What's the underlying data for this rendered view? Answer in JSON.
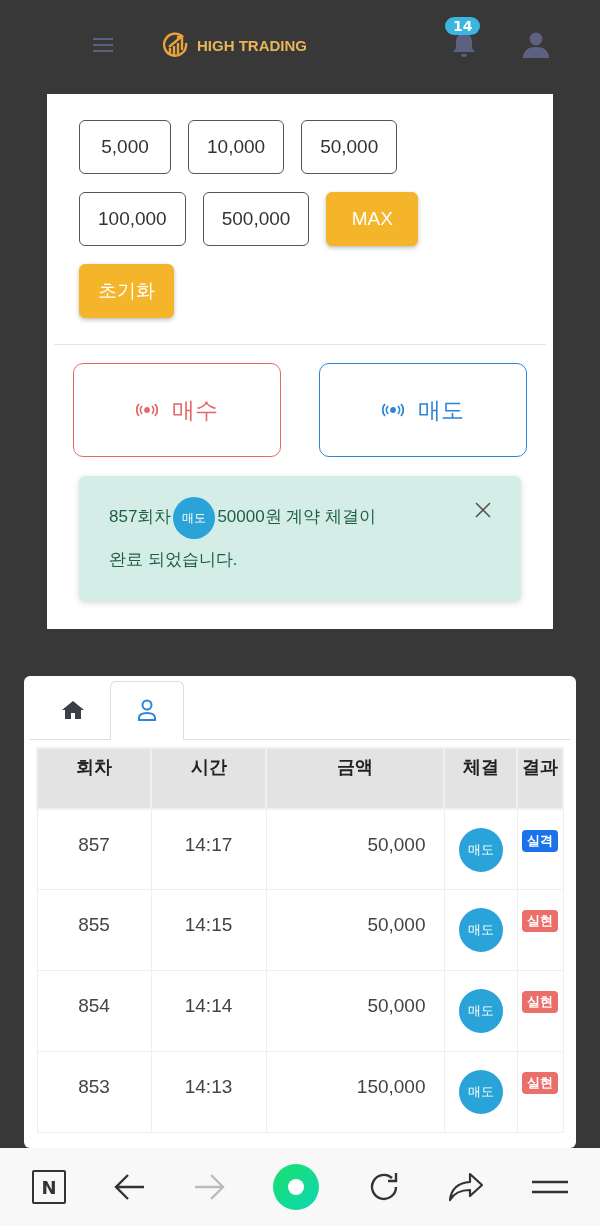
{
  "header": {
    "logo_text": "HIGH TRADING",
    "notification_count": "14"
  },
  "amount_buttons": [
    {
      "label": "5,000",
      "kind": "amount"
    },
    {
      "label": "10,000",
      "kind": "amount"
    },
    {
      "label": "50,000",
      "kind": "amount"
    },
    {
      "label": "100,000",
      "kind": "amount"
    },
    {
      "label": "500,000",
      "kind": "amount"
    },
    {
      "label": "MAX",
      "kind": "action"
    },
    {
      "label": "초기화",
      "kind": "action"
    }
  ],
  "trade_buttons": [
    {
      "label": "매수",
      "kind": "buy"
    },
    {
      "label": "매도",
      "kind": "sell"
    }
  ],
  "alert": {
    "round": "857회차",
    "side": "매도",
    "message": "50000원 계약 체결이",
    "message_line2": "완료 되었습니다."
  },
  "tabs": [
    {
      "kind": "home",
      "selected": false
    },
    {
      "kind": "user",
      "selected": true
    }
  ],
  "table": {
    "columns": [
      "회차",
      "시간",
      "금액",
      "체결",
      "결과"
    ],
    "rows": [
      {
        "round": "857",
        "time": "14:17",
        "amount": "50,000",
        "side": "매도",
        "result": "실격",
        "color": "#1a73e8"
      },
      {
        "round": "855",
        "time": "14:15",
        "amount": "50,000",
        "side": "매도",
        "result": "실현",
        "color": "#ea6f6a"
      },
      {
        "round": "854",
        "time": "14:14",
        "amount": "50,000",
        "side": "매도",
        "result": "실현",
        "color": "#ea6f6a"
      },
      {
        "round": "853",
        "time": "14:13",
        "amount": "150,000",
        "side": "매도",
        "result": "실현",
        "color": "#ea6f6a"
      }
    ]
  },
  "browser_bar": {
    "logo_letter": "N",
    "forward_enabled": false
  }
}
